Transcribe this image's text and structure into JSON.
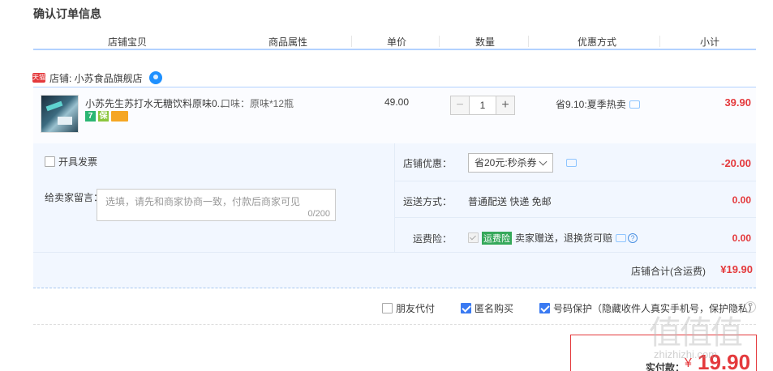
{
  "page_title": "确认订单信息",
  "columns": [
    "店铺宝贝",
    "商品属性",
    "单价",
    "数量",
    "优惠方式",
    "小计"
  ],
  "shop": {
    "tmall_badge": "天猫",
    "label": "店铺: 小苏食品旗舰店"
  },
  "item": {
    "name": "小苏先生苏打水无糖饮料原味0...",
    "property": "口味：原味*12瓶",
    "badges": [
      "7",
      "保"
    ],
    "price": "49.00",
    "quantity": "1",
    "qty_minus": "−",
    "qty_plus": "+",
    "discount": "省9.10:夏季热卖",
    "subtotal": "39.90"
  },
  "invoice_label": "开具发票",
  "note": {
    "label": "给卖家留言：",
    "placeholder": "选填，请先和商家协商一致，付款后商家可见",
    "count": "0/200"
  },
  "shop_coupon": {
    "label": "店铺优惠：",
    "selected": "省20元:秒杀券",
    "amount": "-20.00"
  },
  "delivery": {
    "label": "运送方式：",
    "value": "普通配送 快递 免邮",
    "amount": "0.00"
  },
  "insurance": {
    "label": "运费险：",
    "badge": "运费险",
    "value": "卖家赠送，退换货可赔",
    "amount": "0.00",
    "help": "?"
  },
  "shop_total": {
    "label": "店铺合计(含运费)",
    "value": "¥19.90"
  },
  "options": {
    "friend_pay": "朋友代付",
    "anonymous": "匿名购买",
    "number_protect": "号码保护（隐藏收件人真实手机号，保护隐私）"
  },
  "payment": {
    "label": "实付款：",
    "currency": "¥",
    "amount": "19.90"
  },
  "watermark": {
    "glyphs": "值值值",
    "url": "zhizhizhi.com"
  },
  "colors": {
    "accent_red": "#e4393c",
    "accent_blue": "#b2d1ff",
    "panel_bg": "#f2f7ff"
  }
}
